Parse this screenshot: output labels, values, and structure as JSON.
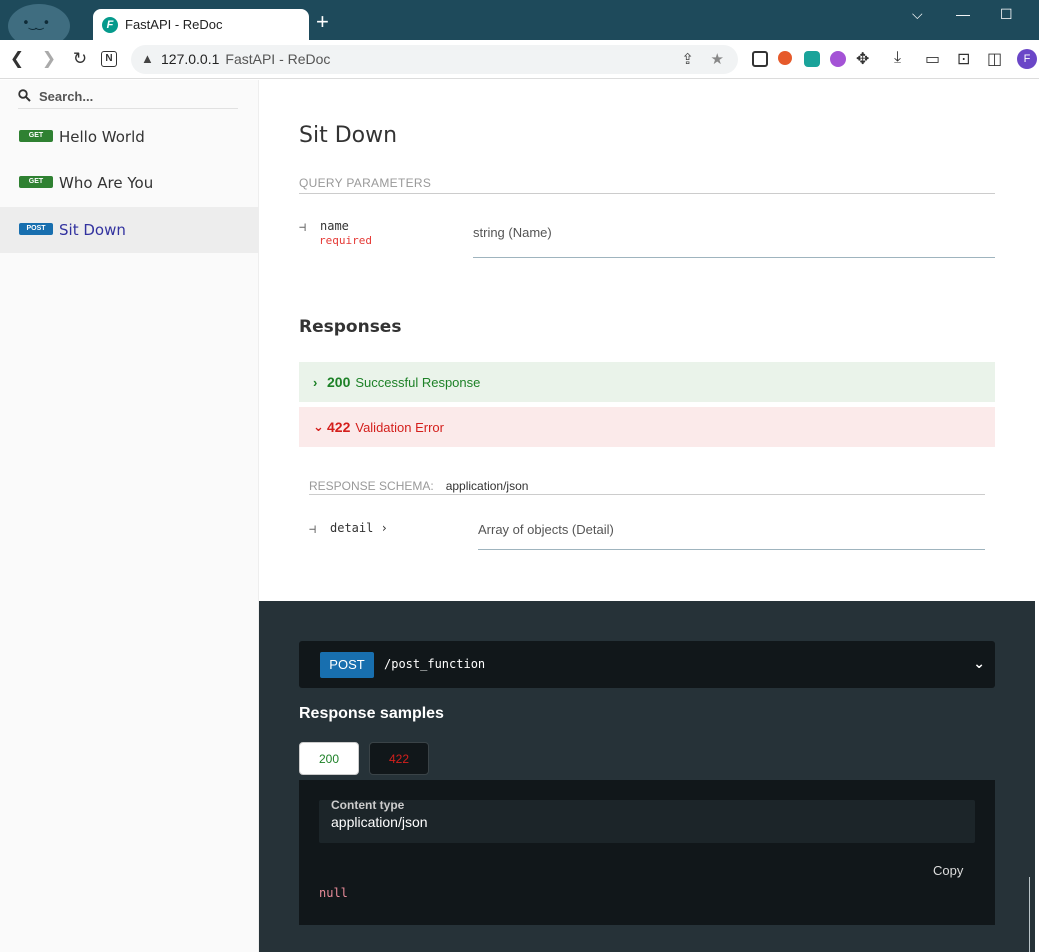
{
  "browser": {
    "tab_title": "FastAPI - ReDoc",
    "favicon_letter": "F",
    "new_tab": "+",
    "address_host": "127.0.0.1",
    "address_rest": "FastAPI - ReDoc",
    "profile_initial": "F",
    "n_badge": "N",
    "window_controls": {
      "dropdown": "⌵",
      "minimize": "—",
      "maximize": "☐"
    }
  },
  "sidebar": {
    "search_placeholder": "Search...",
    "items": [
      {
        "method": "GET",
        "label": "Hello World",
        "active": false
      },
      {
        "method": "GET",
        "label": "Who Are You",
        "active": false
      },
      {
        "method": "POST",
        "label": "Sit Down",
        "active": true
      }
    ]
  },
  "operation": {
    "title": "Sit Down",
    "query_params_caption": "QUERY PARAMETERS",
    "params": [
      {
        "connector": "⊣",
        "name": "name",
        "required": "required",
        "type": "string (Name)"
      }
    ],
    "responses_title": "Responses",
    "responses": [
      {
        "chevron": "›",
        "code": "200",
        "description": "Successful Response",
        "status": "success",
        "expanded": false
      },
      {
        "chevron": "⌄",
        "code": "422",
        "description": "Validation Error",
        "status": "error",
        "expanded": true
      }
    ],
    "response_schema_caption": "RESPONSE SCHEMA:",
    "response_schema_content_type": "application/json",
    "schema_fields": [
      {
        "connector": "⊣",
        "name": "detail",
        "expand": "›",
        "type": "Array of objects (Detail)"
      }
    ]
  },
  "right_panel": {
    "method": "POST",
    "path": "/post_function",
    "response_samples_title": "Response samples",
    "tabs": [
      "200",
      "422"
    ],
    "content_type_label": "Content type",
    "content_type_value": "application/json",
    "copy_label": "Copy",
    "sample_body": "null"
  },
  "colors": {
    "get": "#2f8132",
    "post": "#186faf",
    "success": "#1d8127",
    "error": "#d41f1c",
    "active_link": "#32329f",
    "dark_panel": "#263238",
    "titlebar": "#1e4a5b"
  }
}
